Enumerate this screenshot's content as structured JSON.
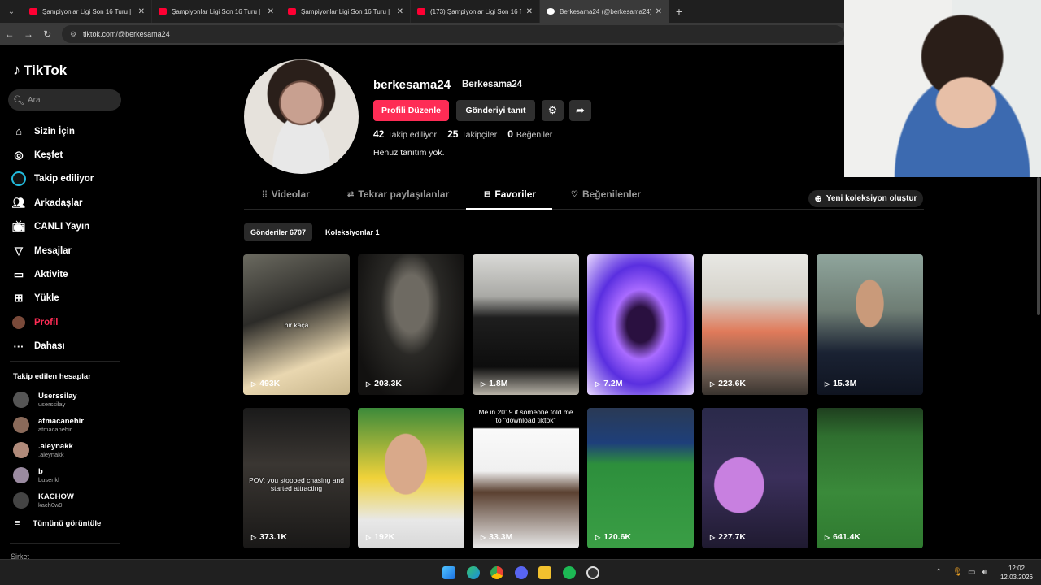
{
  "browser": {
    "tabs": [
      {
        "title": "Şampiyonlar Ligi Son 16 Turu |",
        "active": false
      },
      {
        "title": "Şampiyonlar Ligi Son 16 Turu |",
        "active": false
      },
      {
        "title": "Şampiyonlar Ligi Son 16 Turu |",
        "active": false
      },
      {
        "title": "(173) Şampiyonlar Ligi Son 16 T",
        "active": false
      },
      {
        "title": "Berkesama24 (@berkesama24)",
        "active": true
      }
    ],
    "new_tab": "+",
    "url": "tiktok.com/@berkesama24"
  },
  "sidebar": {
    "brand": "TikTok",
    "search_placeholder": "Ara",
    "items": [
      {
        "label": "Sizin İçin",
        "icon": "home-icon"
      },
      {
        "label": "Keşfet",
        "icon": "compass-icon"
      },
      {
        "label": "Takip ediliyor",
        "icon": "following-icon"
      },
      {
        "label": "Arkadaşlar",
        "icon": "friends-icon"
      },
      {
        "label": "CANLI Yayın",
        "icon": "live-icon"
      },
      {
        "label": "Mesajlar",
        "icon": "messages-icon"
      },
      {
        "label": "Aktivite",
        "icon": "activity-icon"
      },
      {
        "label": "Yükle",
        "icon": "upload-icon"
      },
      {
        "label": "Profil",
        "icon": "profile-avatar"
      },
      {
        "label": "Dahası",
        "icon": "more-icon"
      }
    ],
    "following_title": "Takip edilen hesaplar",
    "following": [
      {
        "name": "Userssilay",
        "handle": "userssilay"
      },
      {
        "name": "atmacanehir",
        "handle": "atmacanehir"
      },
      {
        "name": ".aleynakk",
        "handle": ".aleynakk"
      },
      {
        "name": "b",
        "handle": "busenkl"
      },
      {
        "name": "KACHOW",
        "handle": "kach0w9"
      }
    ],
    "see_all": "Tümünü görüntüle",
    "company": "Şirket"
  },
  "profile": {
    "username": "berkesama24",
    "nickname": "Berkesama24",
    "edit_label": "Profili Düzenle",
    "promote_label": "Gönderiyi tanıt",
    "following_count": "42",
    "following_label": "Takip ediliyor",
    "followers_count": "25",
    "followers_label": "Takipçiler",
    "likes_count": "0",
    "likes_label": "Beğeniler",
    "bio": "Henüz tanıtım yok."
  },
  "tabs": {
    "videos": "Videolar",
    "reposts": "Tekrar paylaşılanlar",
    "favorites": "Favoriler",
    "liked": "Beğenilenler",
    "new_collection": "Yeni koleksiyon oluştur",
    "posts": "Gönderiler 6707",
    "collections": "Koleksiyonlar 1"
  },
  "videos": [
    {
      "views": "493K",
      "caption": "bir kaça"
    },
    {
      "views": "203.3K",
      "caption": ""
    },
    {
      "views": "1.8M",
      "caption": ""
    },
    {
      "views": "7.2M",
      "caption": ""
    },
    {
      "views": "223.6K",
      "caption": ""
    },
    {
      "views": "15.3M",
      "caption": ""
    },
    {
      "views": "373.1K",
      "caption": "POV: you stopped chasing and started attracting"
    },
    {
      "views": "192K",
      "caption": ""
    },
    {
      "views": "33.3M",
      "caption": "Me in 2019 if someone told me to \"download tiktok\""
    },
    {
      "views": "120.6K",
      "caption": ""
    },
    {
      "views": "227.7K",
      "caption": ""
    },
    {
      "views": "641.4K",
      "caption": ""
    }
  ],
  "taskbar": {
    "time": "12:02",
    "date": "12.03.2026"
  }
}
